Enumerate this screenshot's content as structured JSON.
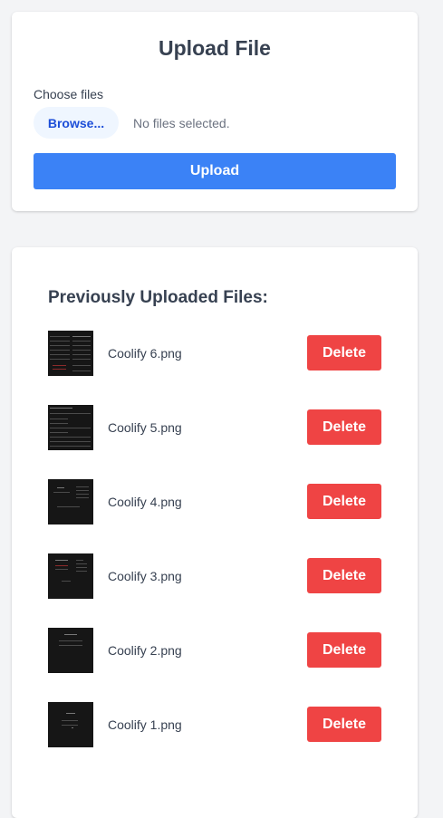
{
  "upload": {
    "title": "Upload File",
    "choose_label": "Choose files",
    "browse_label": "Browse...",
    "no_files_text": "No files selected.",
    "upload_label": "Upload"
  },
  "files": {
    "title": "Previously Uploaded Files:",
    "delete_label": "Delete",
    "items": [
      {
        "name": "Coolify 6.png"
      },
      {
        "name": "Coolify 5.png"
      },
      {
        "name": "Coolify 4.png"
      },
      {
        "name": "Coolify 3.png"
      },
      {
        "name": "Coolify 2.png"
      },
      {
        "name": "Coolify 1.png"
      }
    ]
  },
  "colors": {
    "background": "#f3f4f6",
    "upload_button": "#3b82f6",
    "browse_button": "#eff6ff",
    "delete_button": "#ef4444",
    "thumbnail": "#161616"
  }
}
